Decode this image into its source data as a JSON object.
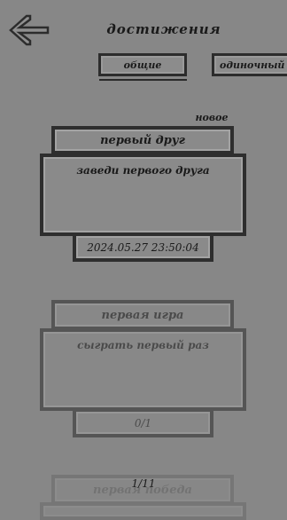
{
  "header": {
    "title": "достижения",
    "back_icon": "arrow-left-icon"
  },
  "tabs": [
    {
      "label": "общие",
      "selected": true
    },
    {
      "label": "одиночный",
      "selected": false
    }
  ],
  "achievements": [
    {
      "badge": "новое",
      "title": "первый друг",
      "description": "заведи первого друга",
      "footer": "2024.05.27 23:50:04",
      "unlocked": true
    },
    {
      "title": "первая игра",
      "description": "сыграть первый раз",
      "footer": "0/1",
      "unlocked": false
    },
    {
      "title": "первая победа",
      "unlocked": false
    }
  ],
  "pager": {
    "text": "1/11"
  },
  "colors": {
    "background": "#878787",
    "border": "#2e2e2e",
    "text": "#1a1a1a"
  }
}
